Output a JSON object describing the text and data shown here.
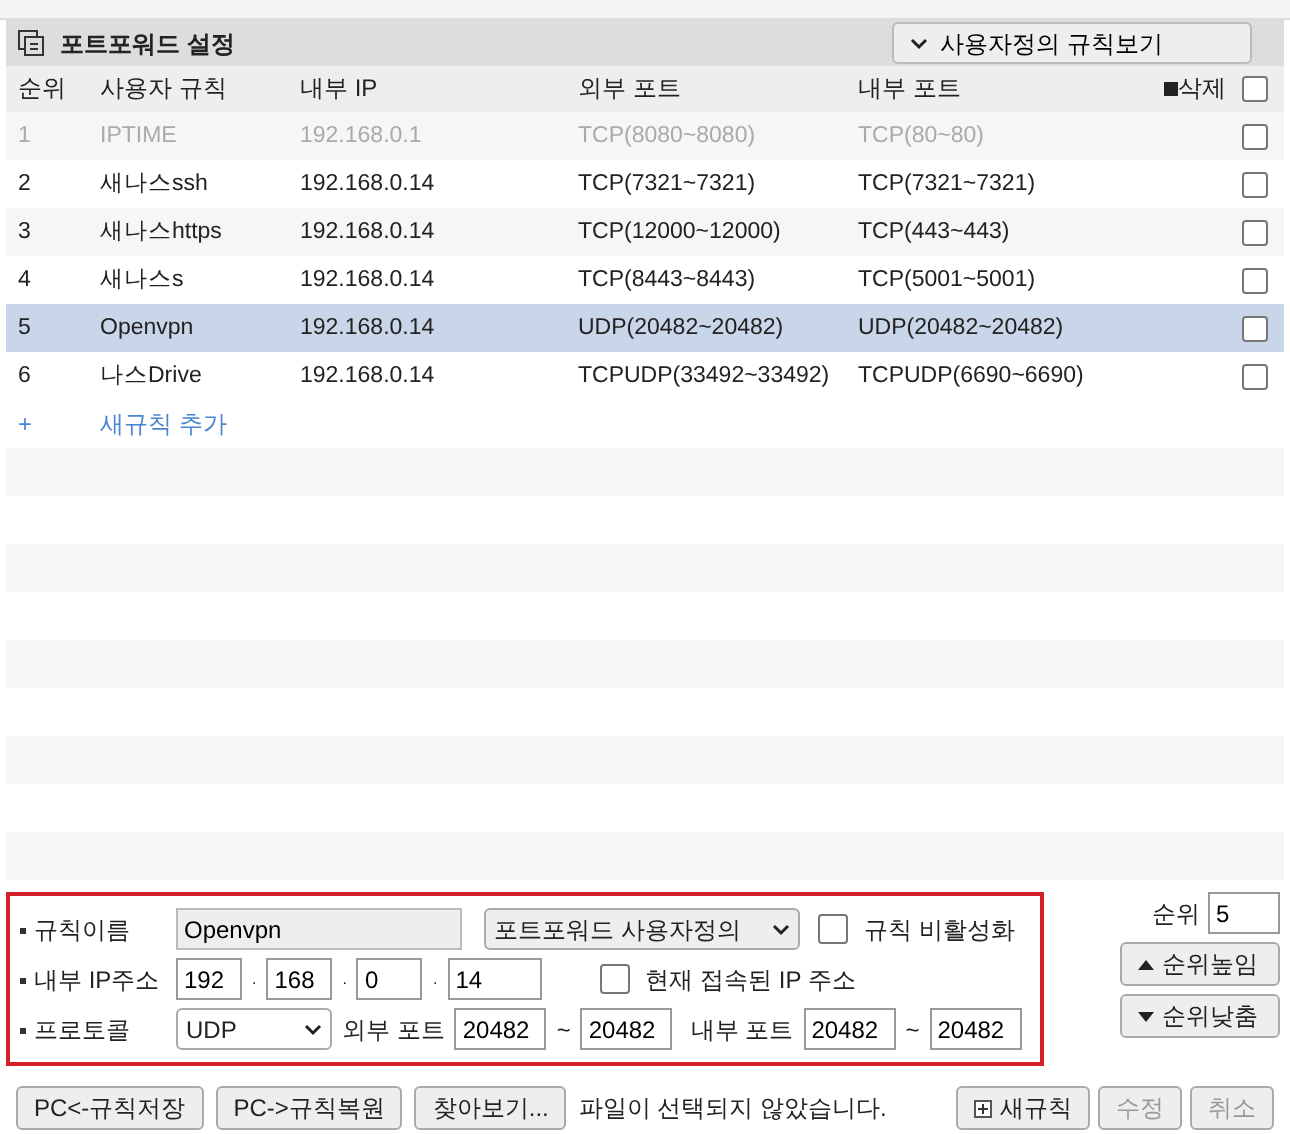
{
  "panel": {
    "title": "포트포워드 설정",
    "view_button": "사용자정의 규칙보기"
  },
  "table": {
    "columns": [
      "순위",
      "사용자 규칙",
      "내부 IP",
      "외부 포트",
      "내부 포트",
      "삭제"
    ],
    "select_all_checked": false,
    "rows": [
      {
        "cells": [
          "1",
          "IPTIME",
          "192.168.0.1",
          "TCP(8080~8080)",
          "TCP(80~80)"
        ],
        "disabled": true,
        "selected": false,
        "checked": false
      },
      {
        "cells": [
          "2",
          "새나스ssh",
          "192.168.0.14",
          "TCP(7321~7321)",
          "TCP(7321~7321)"
        ],
        "disabled": false,
        "selected": false,
        "checked": false
      },
      {
        "cells": [
          "3",
          "새나스https",
          "192.168.0.14",
          "TCP(12000~12000)",
          "TCP(443~443)"
        ],
        "disabled": false,
        "selected": false,
        "checked": false
      },
      {
        "cells": [
          "4",
          "새나스s",
          "192.168.0.14",
          "TCP(8443~8443)",
          "TCP(5001~5001)"
        ],
        "disabled": false,
        "selected": false,
        "checked": false
      },
      {
        "cells": [
          "5",
          "Openvpn",
          "192.168.0.14",
          "UDP(20482~20482)",
          "UDP(20482~20482)"
        ],
        "disabled": false,
        "selected": true,
        "checked": false
      },
      {
        "cells": [
          "6",
          "나스Drive",
          "192.168.0.14",
          "TCPUDP(33492~33492)",
          "TCPUDP(6690~6690)"
        ],
        "disabled": false,
        "selected": false,
        "checked": false
      }
    ],
    "add_row": {
      "icon": "+",
      "label": "새규칙 추가"
    }
  },
  "form": {
    "name_label": "규칙이름",
    "name_value": "Openvpn",
    "type_value": "포트포워드 사용자정의",
    "disable_label": "규칙 비활성화",
    "disable_checked": false,
    "ip_label": "내부 IP주소",
    "ip": [
      "192",
      "168",
      "0",
      "14"
    ],
    "ip_separator": ".",
    "current_ip_label": "현재 접속된 IP 주소",
    "current_ip_checked": false,
    "protocol_label": "프로토콜",
    "protocol_value": "UDP",
    "ext_label": "외부 포트",
    "ext_from": "20482",
    "ext_to": "20482",
    "int_label": "내부 포트",
    "int_from": "20482",
    "int_to": "20482",
    "tilde": "~"
  },
  "order": {
    "label": "순위",
    "value": "5",
    "up": "순위높임",
    "down": "순위낮춤"
  },
  "footer": {
    "buttons": [
      "PC<-규칙저장",
      "PC->규칙복원",
      "찾아보기..."
    ],
    "file_status": "파일이 선택되지 않았습니다.",
    "right_buttons": [
      {
        "label": "새규칙",
        "kind": "new",
        "disabled": false
      },
      {
        "label": "수정",
        "kind": "plain",
        "disabled": true
      },
      {
        "label": "취소",
        "kind": "plain",
        "disabled": true
      }
    ]
  }
}
